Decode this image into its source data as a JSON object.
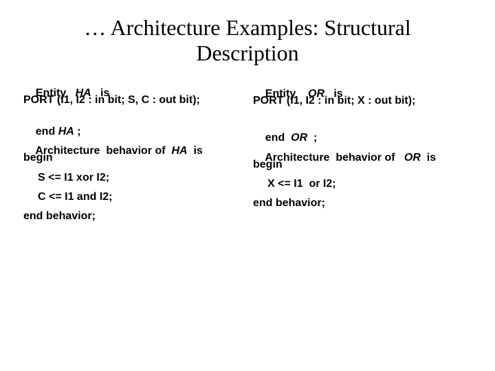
{
  "slide": {
    "title_line1": "… Architecture Examples: Structural",
    "title_line2": "Description"
  },
  "left_code": {
    "entity_kw": "Entity",
    "entity_name": "HA",
    "entity_is": "is",
    "port": "PORT (I1, I2 : in bit; S, C : out bit);",
    "end_kw": "end",
    "end_name": "HA",
    "end_semi": ";",
    "arch_prefix": "Architecture  behavior of",
    "arch_name": "HA",
    "arch_is": "is",
    "begin": "begin",
    "stmt1": "S <= I1 xor I2;",
    "stmt2": "C <= I1 and I2;",
    "end_behavior": "end behavior;"
  },
  "right_code": {
    "entity_kw": "Entity",
    "entity_name": "OR",
    "entity_is": "is",
    "port": "PORT (I1, I2 : in bit; X : out bit);",
    "end_kw": "end",
    "end_name": "OR",
    "end_semi": ";",
    "arch_prefix": "Architecture  behavior of",
    "arch_name": "OR",
    "arch_is": "is",
    "begin": "begin",
    "stmt1": "X <= I1  or I2;",
    "end_behavior": "end behavior;"
  }
}
